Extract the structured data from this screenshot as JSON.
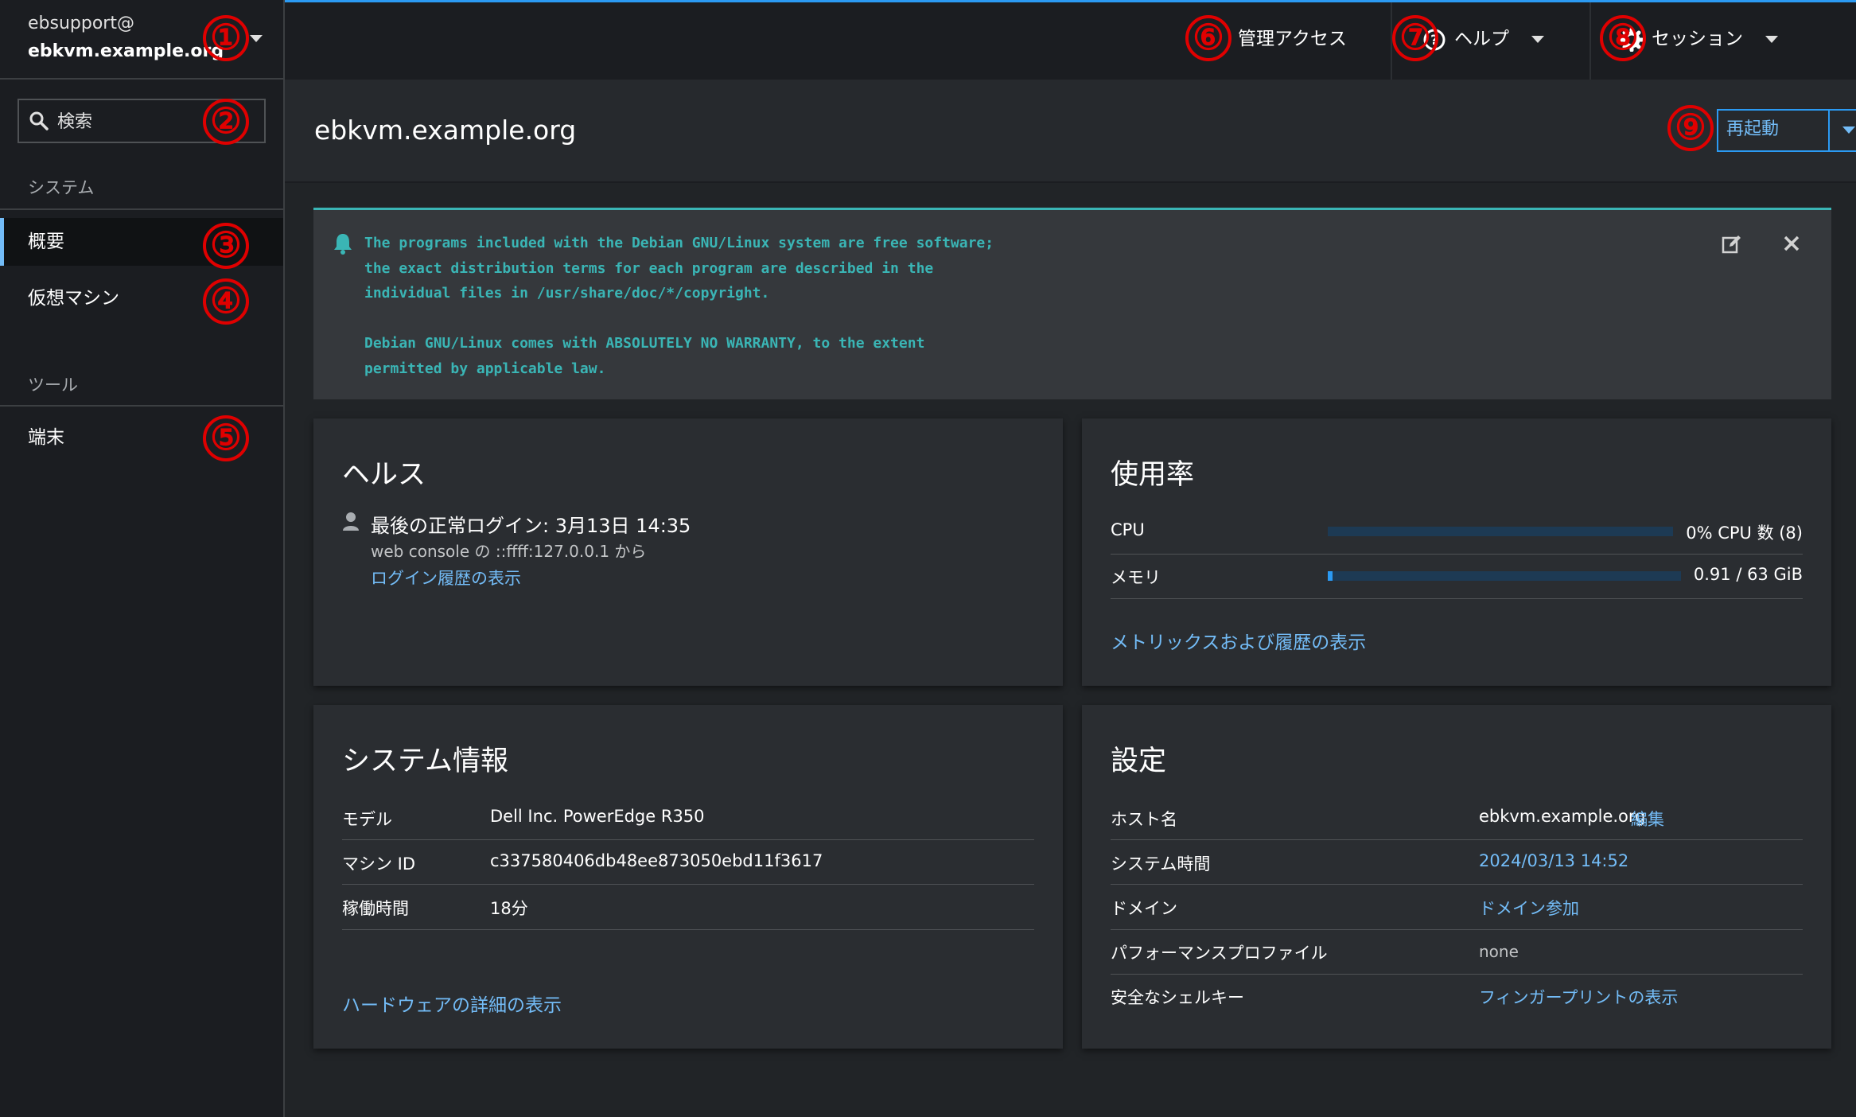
{
  "sidebar": {
    "user": "ebsupport@",
    "host": "ebkvm.example.org",
    "search_placeholder": "検索",
    "section_system": "システム",
    "items": [
      {
        "label": "概要"
      },
      {
        "label": "仮想マシン"
      }
    ],
    "section_tools": "ツール",
    "tools": [
      {
        "label": "端末"
      }
    ]
  },
  "masthead": {
    "admin_access": "管理アクセス",
    "help": "ヘルプ",
    "session": "セッション"
  },
  "header": {
    "title": "ebkvm.example.org",
    "restart": "再起動"
  },
  "motd": {
    "text": "The programs included with the Debian GNU/Linux system are free software;\nthe exact distribution terms for each program are described in the\nindividual files in /usr/share/doc/*/copyright.\n\nDebian GNU/Linux comes with ABSOLUTELY NO WARRANTY, to the extent\npermitted by applicable law."
  },
  "health": {
    "title": "ヘルス",
    "last_login": "最後の正常ログイン: 3月13日 14:35",
    "login_from": "web console の ::ffff:127.0.0.1 から",
    "history_link": "ログイン履歴の表示"
  },
  "usage": {
    "title": "使用率",
    "cpu_label": "CPU",
    "cpu_value": "0% CPU 数 (8)",
    "cpu_fraction": 0.0,
    "mem_label": "メモリ",
    "mem_value": "0.91 / 63 GiB",
    "mem_fraction": 0.0144,
    "metrics_link": "メトリックスおよび履歴の表示"
  },
  "sysinfo": {
    "title": "システム情報",
    "rows": [
      {
        "label": "モデル",
        "value": "Dell Inc. PowerEdge R350"
      },
      {
        "label": "マシン ID",
        "value": "c337580406db48ee873050ebd11f3617"
      },
      {
        "label": "稼働時間",
        "value": "18分"
      }
    ],
    "hardware_link": "ハードウェアの詳細の表示"
  },
  "config": {
    "title": "設定",
    "hostname_label": "ホスト名",
    "hostname_value": "ebkvm.example.org",
    "hostname_edit": "編集",
    "time_label": "システム時間",
    "time_value": "2024/03/13 14:52",
    "domain_label": "ドメイン",
    "domain_value": "ドメイン参加",
    "profile_label": "パフォーマンスプロファイル",
    "profile_value": "none",
    "ssh_label": "安全なシェルキー",
    "ssh_value": "フィンガープリントの表示"
  },
  "annotations": [
    "①",
    "②",
    "③",
    "④",
    "⑤",
    "⑥",
    "⑦",
    "⑧",
    "⑨"
  ],
  "colors": {
    "accent": "#2b9af3",
    "link": "#73bcf7",
    "motd": "#3ab5b5",
    "annotation": "#e00000"
  }
}
